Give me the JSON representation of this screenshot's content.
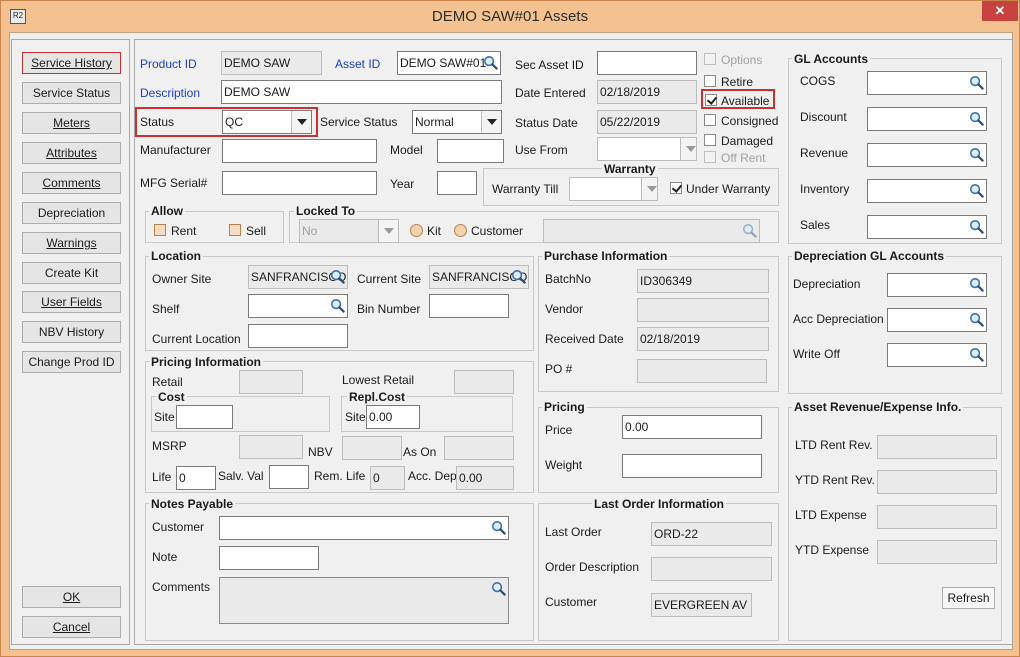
{
  "window": {
    "title": "DEMO SAW#01 Assets",
    "app_icon_text": "R2",
    "close_glyph": "✕"
  },
  "left_buttons": {
    "service_history": "Service History",
    "service_status": "Service Status",
    "meters": "Meters",
    "attributes": "Attributes",
    "comments": "Comments",
    "depreciation": "Depreciation",
    "warnings": "Warnings",
    "create_kit": "Create Kit",
    "user_fields": "User Fields",
    "nbv_history": "NBV History",
    "change_prod_id": "Change Prod ID",
    "ok": "OK",
    "cancel": "Cancel"
  },
  "header": {
    "product_id_label": "Product ID",
    "product_id": "DEMO SAW",
    "asset_id_label": "Asset ID",
    "asset_id": "DEMO SAW#01",
    "description_label": "Description",
    "description": "DEMO SAW",
    "status_label": "Status",
    "status": "QC",
    "service_status_label": "Service Status",
    "service_status": "Normal",
    "manufacturer_label": "Manufacturer",
    "manufacturer": "",
    "model_label": "Model",
    "model": "",
    "mfg_serial_label": "MFG Serial#",
    "mfg_serial": "",
    "year_label": "Year",
    "year": "",
    "sec_asset_id_label": "Sec Asset ID",
    "sec_asset_id": "",
    "date_entered_label": "Date Entered",
    "date_entered": "02/18/2019",
    "status_date_label": "Status Date",
    "status_date": "05/22/2019",
    "use_from_label": "Use From",
    "use_from": ""
  },
  "flags": {
    "options": {
      "label": "Options",
      "checked": false
    },
    "retire": {
      "label": "Retire",
      "checked": false
    },
    "available": {
      "label": "Available",
      "checked": true
    },
    "consigned": {
      "label": "Consigned",
      "checked": false
    },
    "damaged": {
      "label": "Damaged",
      "checked": false
    },
    "off_rent": {
      "label": "Off Rent",
      "checked": false
    }
  },
  "warranty": {
    "title": "Warranty",
    "till_label": "Warranty Till",
    "till": "",
    "under_label": "Under Warranty",
    "under": true
  },
  "allow": {
    "title": "Allow",
    "rent_label": "Rent",
    "sell_label": "Sell"
  },
  "locked_to": {
    "title": "Locked To",
    "value": "No",
    "kit_label": "Kit",
    "customer_label": "Customer",
    "customer": ""
  },
  "location": {
    "title": "Location",
    "owner_site_label": "Owner Site",
    "owner_site": "SANFRANCISCO",
    "current_site_label": "Current Site",
    "current_site": "SANFRANCISCO",
    "shelf_label": "Shelf",
    "shelf": "",
    "bin_number_label": "Bin Number",
    "bin_number": "",
    "current_location_label": "Current Location",
    "current_location": ""
  },
  "pricing_info": {
    "title": "Pricing Information",
    "retail_label": "Retail",
    "retail": "",
    "lowest_retail_label": "Lowest Retail",
    "lowest_retail": "",
    "cost_title": "Cost",
    "cost_site_label": "Site",
    "cost_site": "",
    "repl_title": "Repl.Cost",
    "repl_site_label": "Site",
    "repl_site": "0.00",
    "msrp_label": "MSRP",
    "msrp": "",
    "nbv_label": "NBV",
    "nbv": "",
    "as_on_label": "As On",
    "as_on": "",
    "life_label": "Life",
    "life": "0",
    "salv_label": "Salv. Val",
    "salv": "",
    "rem_life_label": "Rem. Life",
    "rem_life": "0",
    "acc_dep_label": "Acc. Dep",
    "acc_dep": "0.00"
  },
  "notes_payable": {
    "title": "Notes Payable",
    "customer_label": "Customer",
    "customer": "",
    "note_label": "Note",
    "note": "",
    "comments_label": "Comments",
    "comments": ""
  },
  "purchase": {
    "title": "Purchase Information",
    "batch_label": "BatchNo",
    "batch": "ID306349",
    "vendor_label": "Vendor",
    "vendor": "",
    "received_label": "Received Date",
    "received": "02/18/2019",
    "po_label": "PO #",
    "po": ""
  },
  "pricing": {
    "title": "Pricing",
    "price_label": "Price",
    "price": "0.00",
    "weight_label": "Weight",
    "weight": ""
  },
  "last_order": {
    "title": "Last Order Information",
    "order_label": "Last Order",
    "order": "ORD-22",
    "desc_label": "Order Description",
    "desc": "",
    "customer_label": "Customer",
    "customer": "EVERGREEN AV I"
  },
  "gl_accounts": {
    "title": "GL Accounts",
    "cogs_label": "COGS",
    "discount_label": "Discount",
    "revenue_label": "Revenue",
    "inventory_label": "Inventory",
    "sales_label": "Sales"
  },
  "dep_gl": {
    "title": "Depreciation GL Accounts",
    "dep_label": "Depreciation",
    "acc_dep_label": "Acc Depreciation",
    "write_off_label": "Write Off"
  },
  "asset_rev": {
    "title": "Asset Revenue/Expense Info.",
    "ltd_rent_label": "LTD Rent Rev.",
    "ytd_rent_label": "YTD Rent Rev.",
    "ltd_exp_label": "LTD Expense",
    "ytd_exp_label": "YTD Expense",
    "refresh": "Refresh"
  }
}
